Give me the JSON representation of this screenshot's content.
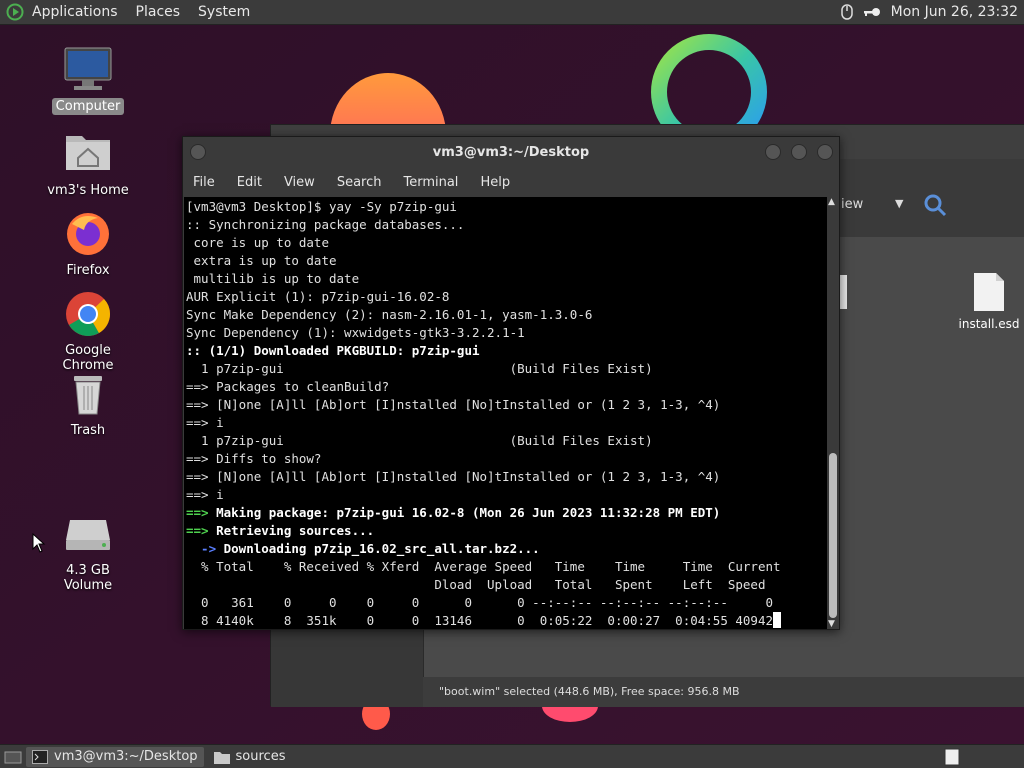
{
  "top_panel": {
    "menus": [
      "Applications",
      "Places",
      "System"
    ],
    "clock": "Mon Jun 26, 23:32",
    "icons": [
      "distro-logo-icon",
      "mouse-icon",
      "key-icon"
    ]
  },
  "desktop": {
    "icons": [
      {
        "label": "Computer",
        "icon": "computer-icon",
        "selected": true
      },
      {
        "label": "vm3's Home",
        "icon": "home-folder-icon"
      },
      {
        "label": "Firefox",
        "icon": "firefox-icon"
      },
      {
        "label": "Google Chrome",
        "icon": "chrome-icon"
      },
      {
        "label": "Trash",
        "icon": "trash-icon"
      },
      {
        "label": "4.3 GB Volume",
        "icon": "drive-icon"
      }
    ]
  },
  "file_manager": {
    "view_label": "iew",
    "file_label": "install.esd",
    "status": "\"boot.wim\" selected (448.6 MB), Free space: 956.8 MB"
  },
  "terminal": {
    "title": "vm3@vm3:~/Desktop",
    "menu": [
      "File",
      "Edit",
      "View",
      "Search",
      "Terminal",
      "Help"
    ],
    "lines": [
      [
        {
          "t": "[vm3@vm3 Desktop]$ yay -Sy p7zip-gui"
        }
      ],
      [
        {
          "t": ":: Synchronizing package databases..."
        }
      ],
      [
        {
          "t": " core is up to date"
        }
      ],
      [
        {
          "t": " extra is up to date"
        }
      ],
      [
        {
          "t": " multilib is up to date"
        }
      ],
      [
        {
          "t": "AUR Explicit (1): p7zip-gui-16.02-8"
        }
      ],
      [
        {
          "t": "Sync Make Dependency (2): nasm-2.16.01-1, yasm-1.3.0-6"
        }
      ],
      [
        {
          "t": "Sync Dependency (1): wxwidgets-gtk3-3.2.2.1-1"
        }
      ],
      [
        {
          "t": ":: (1/1) Downloaded PKGBUILD: p7zip-gui",
          "s": "b"
        }
      ],
      [
        {
          "t": "  1 p7zip-gui                              (Build Files Exist)"
        }
      ],
      [
        {
          "t": "==> Packages to cleanBuild?"
        }
      ],
      [
        {
          "t": "==> [N]one [A]ll [Ab]ort [I]nstalled [No]tInstalled or (1 2 3, 1-3, ^4)"
        }
      ],
      [
        {
          "t": "==> i"
        }
      ],
      [
        {
          "t": "  1 p7zip-gui                              (Build Files Exist)"
        }
      ],
      [
        {
          "t": "==> Diffs to show?"
        }
      ],
      [
        {
          "t": "==> [N]one [A]ll [Ab]ort [I]nstalled [No]tInstalled or (1 2 3, 1-3, ^4)"
        }
      ],
      [
        {
          "t": "==> i"
        }
      ],
      [
        {
          "t": "==>",
          "s": "g"
        },
        {
          "t": " Making package: p7zip-gui 16.02-8 (Mon 26 Jun 2023 11:32:28 PM EDT)",
          "s": "b"
        }
      ],
      [
        {
          "t": "==>",
          "s": "g"
        },
        {
          "t": " Retrieving sources...",
          "s": "b"
        }
      ],
      [
        {
          "t": "  ->",
          "s": "bl"
        },
        {
          "t": " Downloading p7zip_16.02_src_all.tar.bz2...",
          "s": "b"
        }
      ],
      [
        {
          "t": "  % Total    % Received % Xferd  Average Speed   Time    Time     Time  Current"
        }
      ],
      [
        {
          "t": "                                 Dload  Upload   Total   Spent    Left  Speed"
        }
      ],
      [
        {
          "t": "  0   361    0     0    0     0      0      0 --:--:-- --:--:-- --:--:--     0"
        }
      ],
      [
        {
          "t": "  8 4140k    8  351k    0     0  13146      0  0:05:22  0:00:27  0:04:55 40942"
        }
      ]
    ]
  },
  "taskbar": {
    "tasks": [
      {
        "label": "vm3@vm3:~/Desktop",
        "icon": "terminal-icon",
        "active": true
      },
      {
        "label": "sources",
        "icon": "folder-icon",
        "active": false
      }
    ]
  }
}
